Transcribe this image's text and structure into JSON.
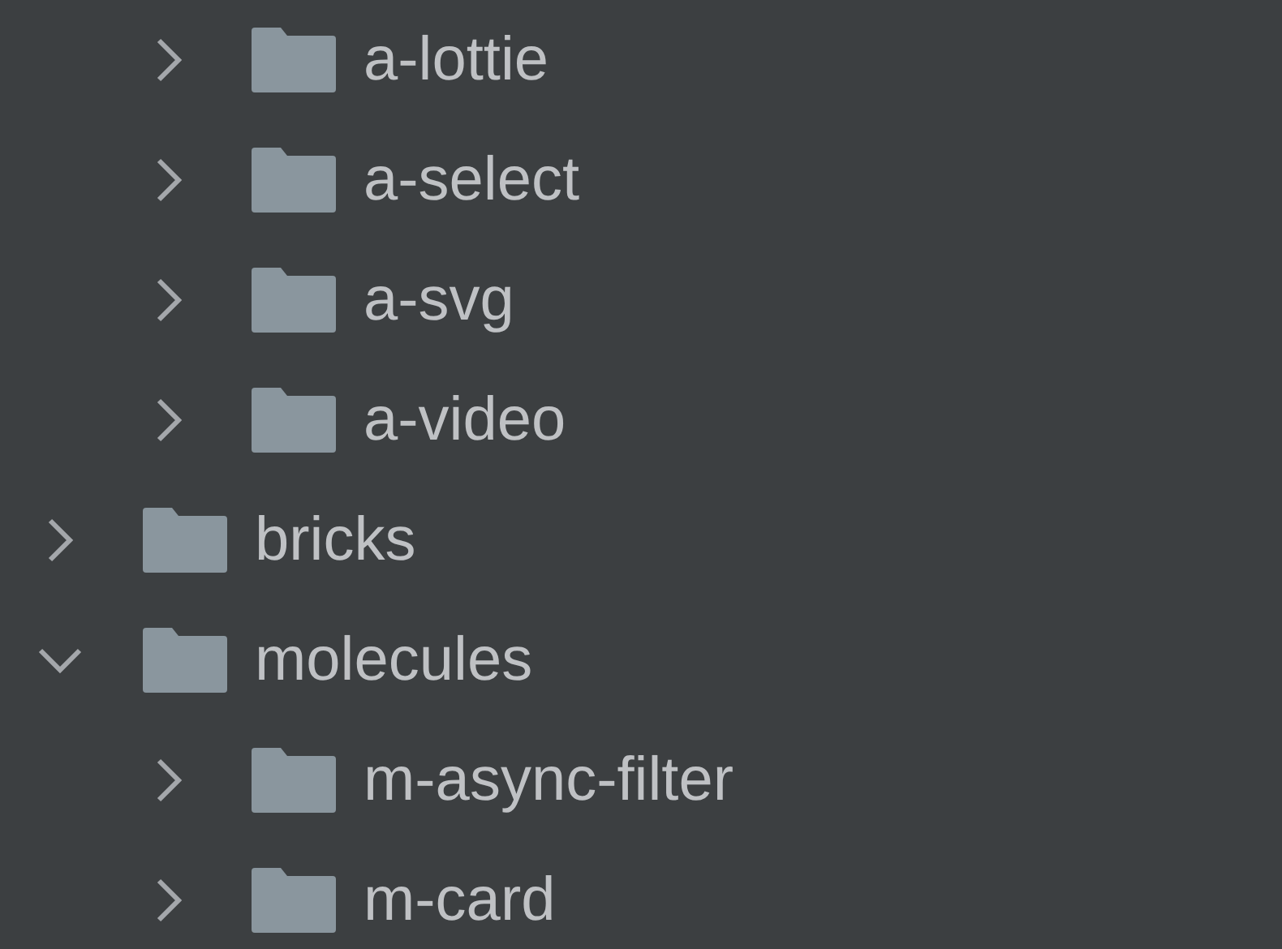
{
  "tree": [
    {
      "children": [
        {
          "name": "a-lottie",
          "expanded": false
        },
        {
          "name": "a-select",
          "expanded": false
        },
        {
          "name": "a-svg",
          "expanded": false
        },
        {
          "name": "a-video",
          "expanded": false
        }
      ]
    },
    {
      "name": "bricks",
      "expanded": false
    },
    {
      "name": "molecules",
      "expanded": true,
      "children": [
        {
          "name": "m-async-filter",
          "expanded": false
        },
        {
          "name": "m-card",
          "expanded": false
        }
      ]
    }
  ]
}
